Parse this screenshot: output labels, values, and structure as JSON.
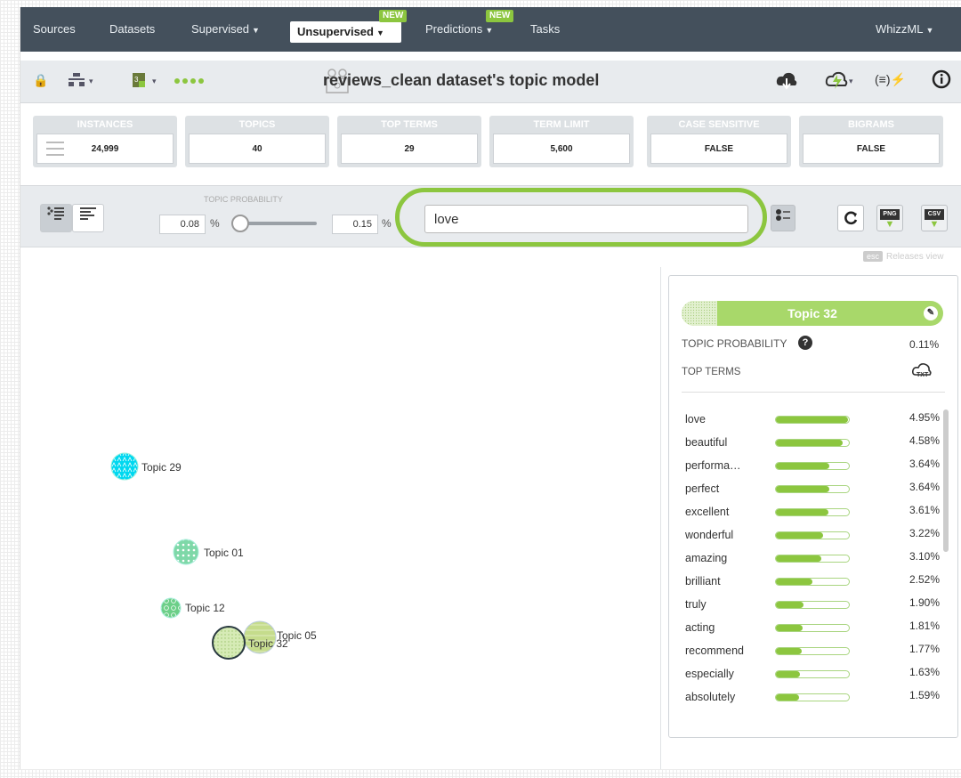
{
  "nav": {
    "items": [
      {
        "label": "Sources"
      },
      {
        "label": "Datasets"
      },
      {
        "label": "Supervised"
      },
      {
        "label": "Unsupervised"
      },
      {
        "label": "Predictions"
      },
      {
        "label": "Tasks"
      },
      {
        "label": "WhizzML"
      }
    ],
    "new_badge": "NEW"
  },
  "header": {
    "title": "reviews_clean dataset's topic model"
  },
  "stats": [
    {
      "label": "INSTANCES",
      "value": "24,999"
    },
    {
      "label": "TOPICS",
      "value": "40"
    },
    {
      "label": "TOP TERMS",
      "value": "29"
    },
    {
      "label": "TERM LIMIT",
      "value": "5,600"
    },
    {
      "label": "CASE SENSITIVE",
      "value": "FALSE"
    },
    {
      "label": "BIGRAMS",
      "value": "FALSE"
    }
  ],
  "controls": {
    "slider_label": "TOPIC PROBABILITY",
    "min_value": "0.08",
    "max_value": "0.15",
    "percent_sign": "%",
    "search_value": "love",
    "png_label": "PNG",
    "csv_label": "CSV",
    "esc_label": "esc",
    "releases_label": "Releases view"
  },
  "topics": [
    {
      "label": "Topic 29",
      "color": "#00d8f0"
    },
    {
      "label": "Topic 01",
      "color": "#7ed8a8"
    },
    {
      "label": "Topic 12",
      "color": "#6ccf88"
    },
    {
      "label": "Topic 32",
      "color": "#c8e4a0"
    },
    {
      "label": "Topic 05",
      "color": "#c5dc8c"
    }
  ],
  "panel": {
    "topic_name": "Topic 32",
    "probability_label": "TOPIC PROBABILITY",
    "probability_value": "0.11%",
    "top_terms_label": "TOP TERMS",
    "terms": [
      {
        "term": "love",
        "pct": "4.95%",
        "value": 4.95
      },
      {
        "term": "beautiful",
        "pct": "4.58%",
        "value": 4.58
      },
      {
        "term": "performa…",
        "pct": "3.64%",
        "value": 3.64
      },
      {
        "term": "perfect",
        "pct": "3.64%",
        "value": 3.64
      },
      {
        "term": "excellent",
        "pct": "3.61%",
        "value": 3.61
      },
      {
        "term": "wonderful",
        "pct": "3.22%",
        "value": 3.22
      },
      {
        "term": "amazing",
        "pct": "3.10%",
        "value": 3.1
      },
      {
        "term": "brilliant",
        "pct": "2.52%",
        "value": 2.52
      },
      {
        "term": "truly",
        "pct": "1.90%",
        "value": 1.9
      },
      {
        "term": "acting",
        "pct": "1.81%",
        "value": 1.81
      },
      {
        "term": "recommend",
        "pct": "1.77%",
        "value": 1.77
      },
      {
        "term": "especially",
        "pct": "1.63%",
        "value": 1.63
      },
      {
        "term": "absolutely",
        "pct": "1.59%",
        "value": 1.59
      }
    ]
  }
}
